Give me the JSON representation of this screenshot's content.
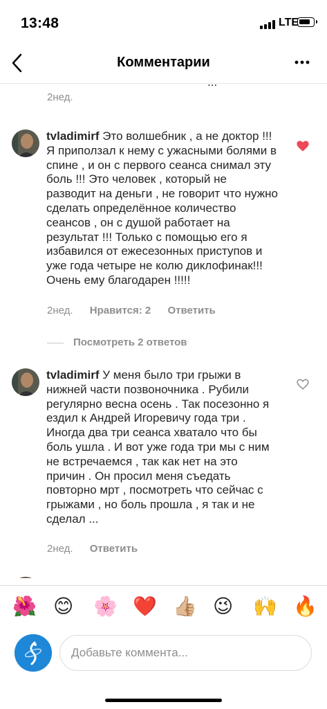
{
  "status_bar": {
    "time": "13:48",
    "network": "LTE"
  },
  "nav": {
    "title": "Комментарии"
  },
  "partial_comment": {
    "text": "...",
    "time": "2нед."
  },
  "comments": [
    {
      "username": "tvladimirf",
      "text": "Это волшебник , а не доктор !!! Я приползал к нему с ужасными болями в спине , и он с первого сеанса снимал эту боль !!! Это человек , который не разводит на деньги , не говорит что нужно сделать определённое количество сеансов , он с душой работает на результат !!! Только с помощью его я избавился от ежесезонных приступов и уже года четыре не колю диклофинак!!! Очень ему благодарен !!!!!",
      "time": "2нед.",
      "likes": "Нравится: 2",
      "reply": "Ответить",
      "liked": true,
      "view_replies": "Посмотреть 2 ответов"
    },
    {
      "username": "tvladimirf",
      "text": "У меня было три грыжи в нижней части позвоночника . Рубили регулярно весна осень . Так посезонно я ездил к Андрей Игоревичу года три . Иногда два три сеанса хватало что бы боль ушла . И вот уже года три мы с ним не встречаемся , так как нет на это причин . Он просил меня съедать повторно мрт , посмотреть что сейчас с грыжами , но боль прошла , я так и не сделал ...",
      "time": "2нед.",
      "reply": "Ответить",
      "liked": false
    }
  ],
  "emoji_bar": [
    "🌺",
    "😊",
    "🌸",
    "❤️",
    "👍🏼",
    "😉",
    "🙌",
    "🔥"
  ],
  "emoji_names": [
    "hibiscus-emoji",
    "smile-emoji",
    "cherry-blossom-emoji",
    "red-heart-emoji",
    "thumbs-up-emoji",
    "wink-emoji",
    "raised-hands-emoji",
    "fire-emoji"
  ],
  "input": {
    "placeholder": "Добавьте коммента..."
  },
  "colors": {
    "like_red": "#ed4956",
    "muted_gray": "#8e8e8e",
    "text": "#262626",
    "avatar_blue": "#1e87d8"
  }
}
